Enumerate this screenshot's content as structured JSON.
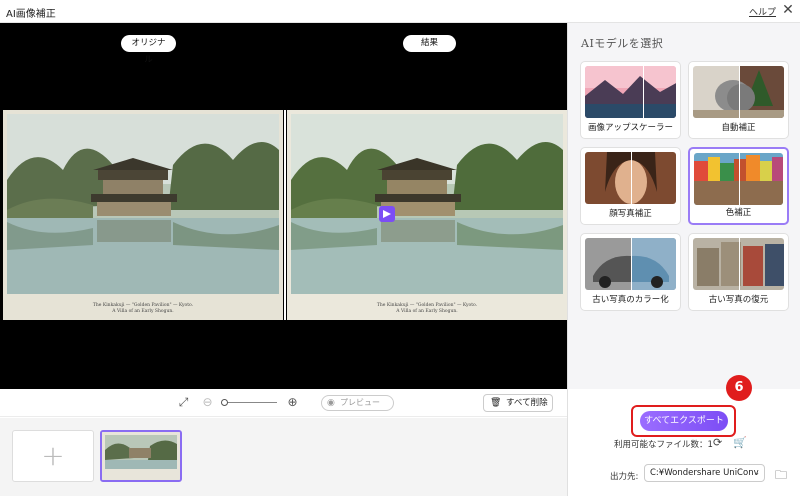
{
  "window": {
    "title": "AI画像補正",
    "help": "ヘルプ",
    "close_glyph": "✕"
  },
  "preview": {
    "original_label": "オリジナル",
    "result_label": "結果",
    "caption_line1": "The Kinkakuji — \"Golden Pavilion\" — Kyoto.",
    "caption_line2": "A Villa of an Early Shogun."
  },
  "toolbar": {
    "fit_glyph": "⤢",
    "zoom_out_glyph": "⊖",
    "zoom_in_glyph": "⊕",
    "preview_label": "プレビュー",
    "delete_all_label": "すべて削除",
    "zoom_level": 0
  },
  "thumbnails": {
    "add_glyph": "+"
  },
  "models": {
    "heading": "AIモデルを選択",
    "items": [
      {
        "label": "画像アップスケーラー",
        "selected": false
      },
      {
        "label": "自動補正",
        "selected": false
      },
      {
        "label": "顔写真補正",
        "selected": false
      },
      {
        "label": "色補正",
        "selected": true
      },
      {
        "label": "古い写真のカラー化",
        "selected": false
      },
      {
        "label": "古い写真の復元",
        "selected": false
      }
    ]
  },
  "export": {
    "button_label": "すべてエクスポート",
    "step_number": "6",
    "files_label": "利用可能なファイル数：1",
    "dest_label": "出力先:",
    "dest_value": "C:¥Wondershare UniConv"
  },
  "colors": {
    "accent": "#8a5cf6",
    "highlight": "#e01d1d"
  }
}
